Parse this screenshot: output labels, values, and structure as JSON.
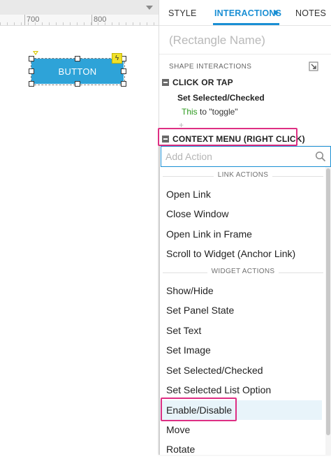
{
  "canvas": {
    "ruler": {
      "labels": [
        "700",
        "800"
      ]
    },
    "widget": {
      "label": "BUTTON"
    }
  },
  "panel": {
    "tabs": [
      {
        "label": "STYLE"
      },
      {
        "label": "INTERACTIONS"
      },
      {
        "label": "NOTES"
      }
    ],
    "shape_name_placeholder": "(Rectangle Name)",
    "section_label": "SHAPE INTERACTIONS",
    "events": [
      {
        "label": "CLICK OR TAP",
        "case": "Set Selected/Checked",
        "action": {
          "target": "This",
          "rest": " to \"toggle\""
        },
        "add_hint": "+"
      },
      {
        "label": "CONTEXT MENU (RIGHT CLICK)"
      }
    ]
  },
  "dropdown": {
    "search": {
      "placeholder": "Add Action",
      "value": ""
    },
    "groups": [
      {
        "header": "LINK ACTIONS",
        "items": [
          "Open Link",
          "Close Window",
          "Open Link in Frame",
          "Scroll to Widget (Anchor Link)"
        ]
      },
      {
        "header": "WIDGET ACTIONS",
        "items": [
          "Show/Hide",
          "Set Panel State",
          "Set Text",
          "Set Image",
          "Set Selected/Checked",
          "Set Selected List Option",
          "Enable/Disable",
          "Move",
          "Rotate"
        ]
      }
    ],
    "hovered_item": "Enable/Disable"
  },
  "colors": {
    "accent": "#1a8fd4",
    "highlight": "#de2f83",
    "button_fill": "#2ea3d8",
    "target_text": "#2c9a1e"
  }
}
